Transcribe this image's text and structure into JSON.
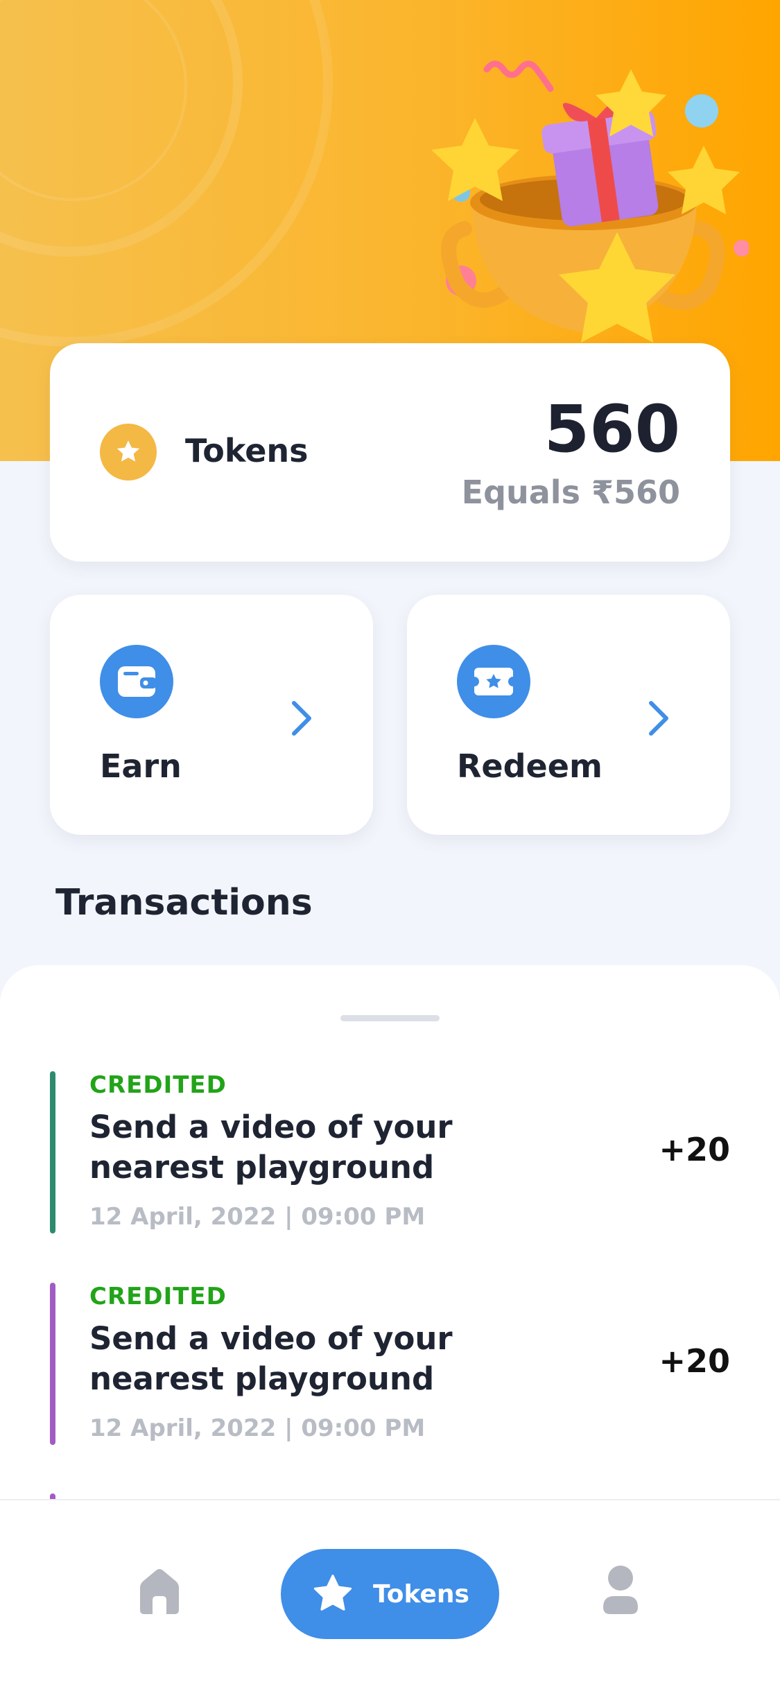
{
  "tokens_card": {
    "label": "Tokens",
    "value": "560",
    "equals": "Equals ₹560"
  },
  "actions": [
    {
      "label": "Earn",
      "icon": "wallet-icon"
    },
    {
      "label": "Redeem",
      "icon": "ticket-icon"
    }
  ],
  "transactions": {
    "title": "Transactions",
    "items": [
      {
        "status": "CREDITED",
        "description": "Send a video of your nearest playground",
        "date": "12 April, 2022 | 09:00 PM",
        "amount": "+20",
        "accent": "#2d8a6e"
      },
      {
        "status": "CREDITED",
        "description": "Send a video of your nearest playground",
        "date": "12 April, 2022 | 09:00 PM",
        "amount": "+20",
        "accent": "#a35bc4"
      }
    ]
  },
  "bottom_nav": {
    "items": [
      {
        "icon": "home-icon",
        "label": ""
      },
      {
        "icon": "star-icon",
        "label": "Tokens",
        "active": true
      },
      {
        "icon": "profile-icon",
        "label": ""
      }
    ]
  },
  "colors": {
    "hero_gradient_start": "#f6c04d",
    "hero_gradient_end": "#ffa500",
    "accent_blue": "#3f8ee8",
    "credited_green": "#22a319",
    "token_gold": "#f4b844"
  }
}
